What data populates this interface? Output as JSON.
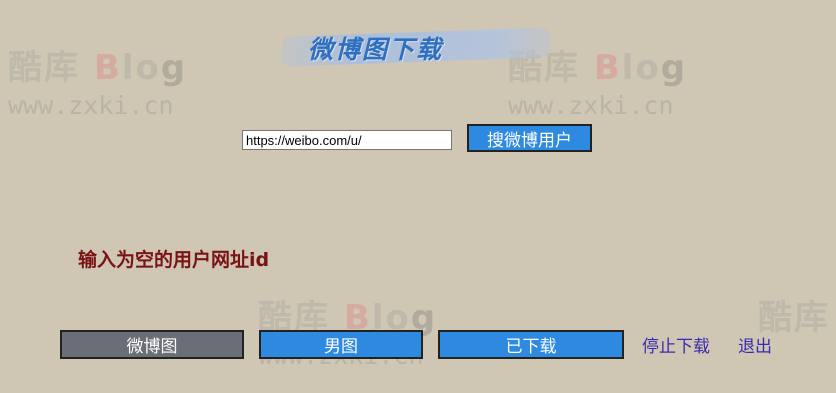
{
  "watermark": {
    "brand_cn": "酷库",
    "brand_b": "B",
    "brand_lo": "lo",
    "brand_g": "g",
    "url": "www.zxki.cn"
  },
  "header": {
    "title": "微博图下载"
  },
  "search": {
    "input_value": "https://weibo.com/u/",
    "button_label": "搜微博用户"
  },
  "message": "输入为空的用户网址id",
  "toolbar": {
    "weibo_images_label": "微博图",
    "male_images_label": "男图",
    "downloaded_label": "已下载",
    "stop_download_label": "停止下载",
    "exit_label": "退出"
  }
}
